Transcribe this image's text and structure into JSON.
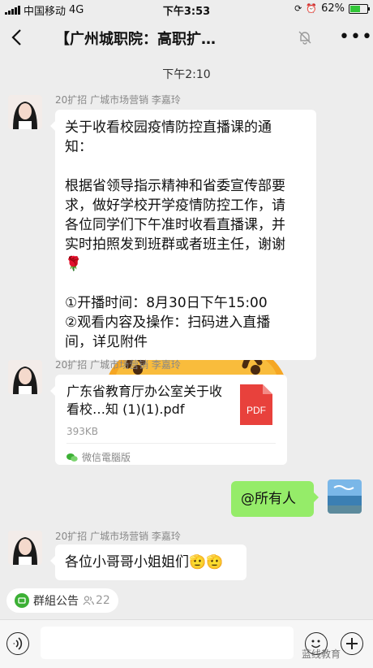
{
  "status_bar": {
    "carrier": "中国移动",
    "network": "4G",
    "time": "下午3:53",
    "battery_pct": "62%",
    "battery_level": 0.62
  },
  "header": {
    "title": "【广州城职院：高职扩…"
  },
  "chat": {
    "timestamp": "下午2:10",
    "messages": [
      {
        "sender": "20扩招 广城市场营销 李嘉玲",
        "text": "关于收看校园疫情防控直播课的通\n知：\n\n根据省领导指示精神和省委宣传部要\n求，做好学校开学疫情防控工作，请\n各位同学们下午准时收看直播课，并\n实时拍照发到班群或者班主任，谢谢\n🌹\n\n①开播时间：8月30日下午15:00\n②观看内容及操作：扫码进入直播\n间，详见附件"
      },
      {
        "sender": "20扩招 广城市场营销 李嘉玲",
        "file": {
          "name": "广东省教育厅办公室关于收看校…知 (1)(1).pdf",
          "size": "393KB",
          "type_label": "PDF",
          "source": "微信電腦版"
        }
      },
      {
        "sender_self": true,
        "text": "@所有人"
      },
      {
        "sender": "20扩招 广城市场营销 李嘉玲",
        "text": "各位小哥哥小姐姐们🫡🫡"
      }
    ]
  },
  "notice": {
    "label": "群組公告",
    "count": "22"
  },
  "watermark": "蓝线教育",
  "colors": {
    "background": "#ededed",
    "self_bubble": "#95ec69",
    "pdf_red": "#e8413c",
    "sticker_orange": "#f5a623"
  }
}
